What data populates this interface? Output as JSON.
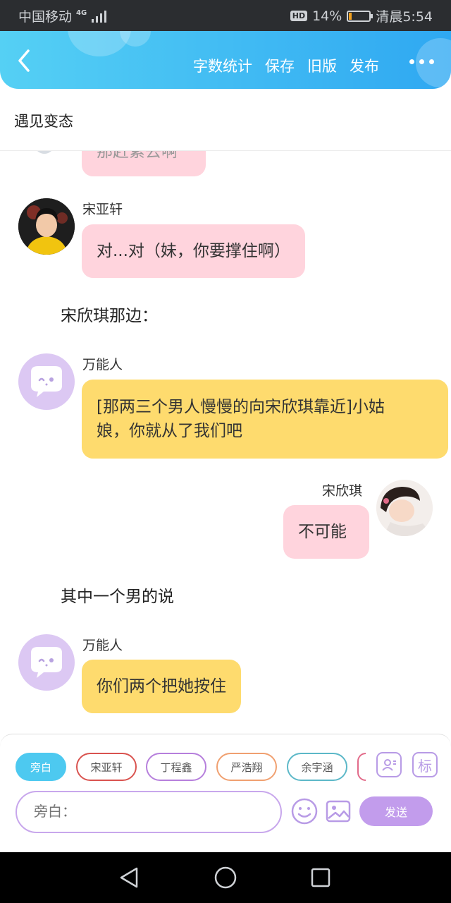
{
  "status_bar": {
    "carrier": "中国移动",
    "network": "4G",
    "hd": "HD",
    "battery": "14%",
    "battery_level": 0.14,
    "time": "清晨5:54"
  },
  "header": {
    "actions": [
      "字数统计",
      "保存",
      "旧版",
      "发布"
    ],
    "gradient_colors": [
      "#55d0f4",
      "#2fa8f2"
    ]
  },
  "story_title": "遇见变态",
  "chat": {
    "partial_message": "那赶紧去啊",
    "messages": [
      {
        "name": "宋亚轩",
        "text": "对...对（妹，你要撑住啊）"
      },
      {
        "narration": "宋欣琪那边："
      },
      {
        "name": "万能人",
        "text_line1": "[那两三个男人慢慢的向宋欣琪靠近]小姑",
        "text_line2": "娘，你就从了我们吧"
      },
      {
        "name": "宋欣琪",
        "text": "不可能"
      },
      {
        "narration": "其中一个男的说"
      },
      {
        "name": "万能人",
        "text": "你们两个把她按住"
      }
    ]
  },
  "composer": {
    "chips": [
      {
        "label": "旁白",
        "color": "#4dc9f0"
      },
      {
        "label": "宋亚轩",
        "color": "#d9534f"
      },
      {
        "label": "丁程鑫",
        "color": "#b67fdc"
      },
      {
        "label": "严浩翔",
        "color": "#f0a070"
      },
      {
        "label": "余宇涵",
        "color": "#5cb8c8"
      }
    ],
    "tag_button": "标",
    "input_placeholder": "旁白：",
    "send_label": "发送"
  },
  "colors": {
    "pink_bubble": "#ffd4dd",
    "yellow_bubble": "#fedb6e",
    "bot_avatar": "#dcc8f3",
    "accent_purple": "#c29cec"
  }
}
